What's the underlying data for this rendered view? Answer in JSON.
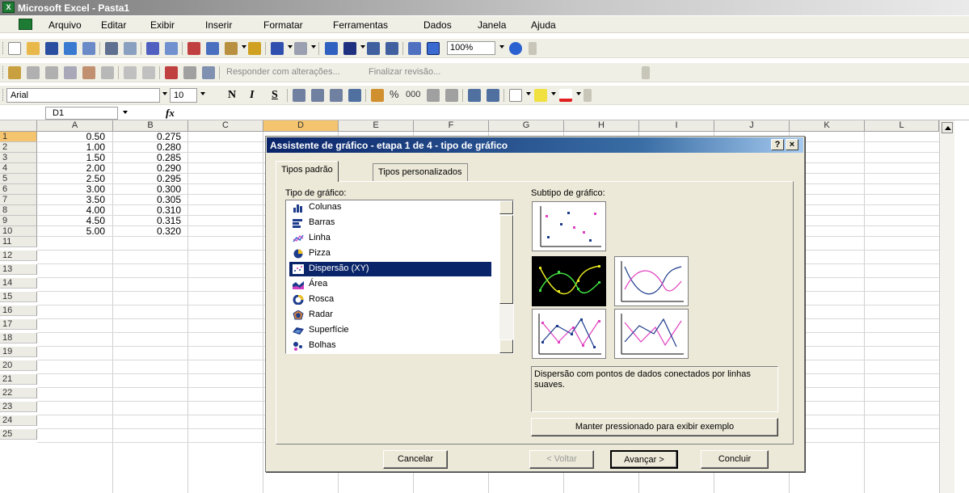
{
  "window": {
    "title": "Microsoft Excel - Pasta1"
  },
  "menu": [
    "Arquivo",
    "Editar",
    "Exibir",
    "Inserir",
    "Formatar",
    "Ferramentas",
    "Dados",
    "Janela",
    "Ajuda"
  ],
  "toolbar": {
    "zoom": "100%",
    "review_text": "Responder com alterações...",
    "end_review": "Finalizar revisão...",
    "font_name": "Arial",
    "font_size": "10",
    "bold": "N",
    "italic": "I",
    "underline": "S",
    "percent": "%",
    "thousands": "000"
  },
  "formula_bar": {
    "name_box": "D1",
    "fx": "fx"
  },
  "grid": {
    "columns": [
      "A",
      "B",
      "C",
      "D",
      "E",
      "F",
      "G",
      "H",
      "I",
      "J",
      "K",
      "L"
    ],
    "rows": [
      "1",
      "2",
      "3",
      "4",
      "5",
      "6",
      "7",
      "8",
      "9",
      "10",
      "11",
      "12",
      "13",
      "14",
      "15",
      "16",
      "17",
      "18",
      "19",
      "20",
      "21",
      "22",
      "23",
      "24",
      "25"
    ],
    "col_a": [
      "0.50",
      "1.00",
      "1.50",
      "2.00",
      "2.50",
      "3.00",
      "3.50",
      "4.00",
      "4.50",
      "5.00"
    ],
    "col_b": [
      "0.275",
      "0.280",
      "0.285",
      "0.290",
      "0.295",
      "0.300",
      "0.305",
      "0.310",
      "0.315",
      "0.320"
    ]
  },
  "dialog": {
    "title": "Assistente de gráfico - etapa 1 de 4 - tipo de gráfico",
    "help_btn": "?",
    "close_btn": "×",
    "tabs": [
      "Tipos padrão",
      "Tipos personalizados"
    ],
    "chart_type_label": "Tipo de gráfico:",
    "subtype_label": "Subtipo de gráfico:",
    "chart_types": [
      "Colunas",
      "Barras",
      "Linha",
      "Pizza",
      "Dispersão (XY)",
      "Área",
      "Rosca",
      "Radar",
      "Superfície",
      "Bolhas"
    ],
    "selected_type": "Dispersão (XY)",
    "description": "Dispersão com pontos de dados conectados por linhas suaves.",
    "preview_button": "Manter pressionado para exibir exemplo",
    "buttons": {
      "cancel": "Cancelar",
      "back": "< Voltar",
      "next": "Avançar >",
      "finish": "Concluir"
    }
  },
  "colors": {
    "accent": "#0a246a",
    "selection_header": "#f5c46e",
    "dialog_bg": "#ece9d8"
  }
}
